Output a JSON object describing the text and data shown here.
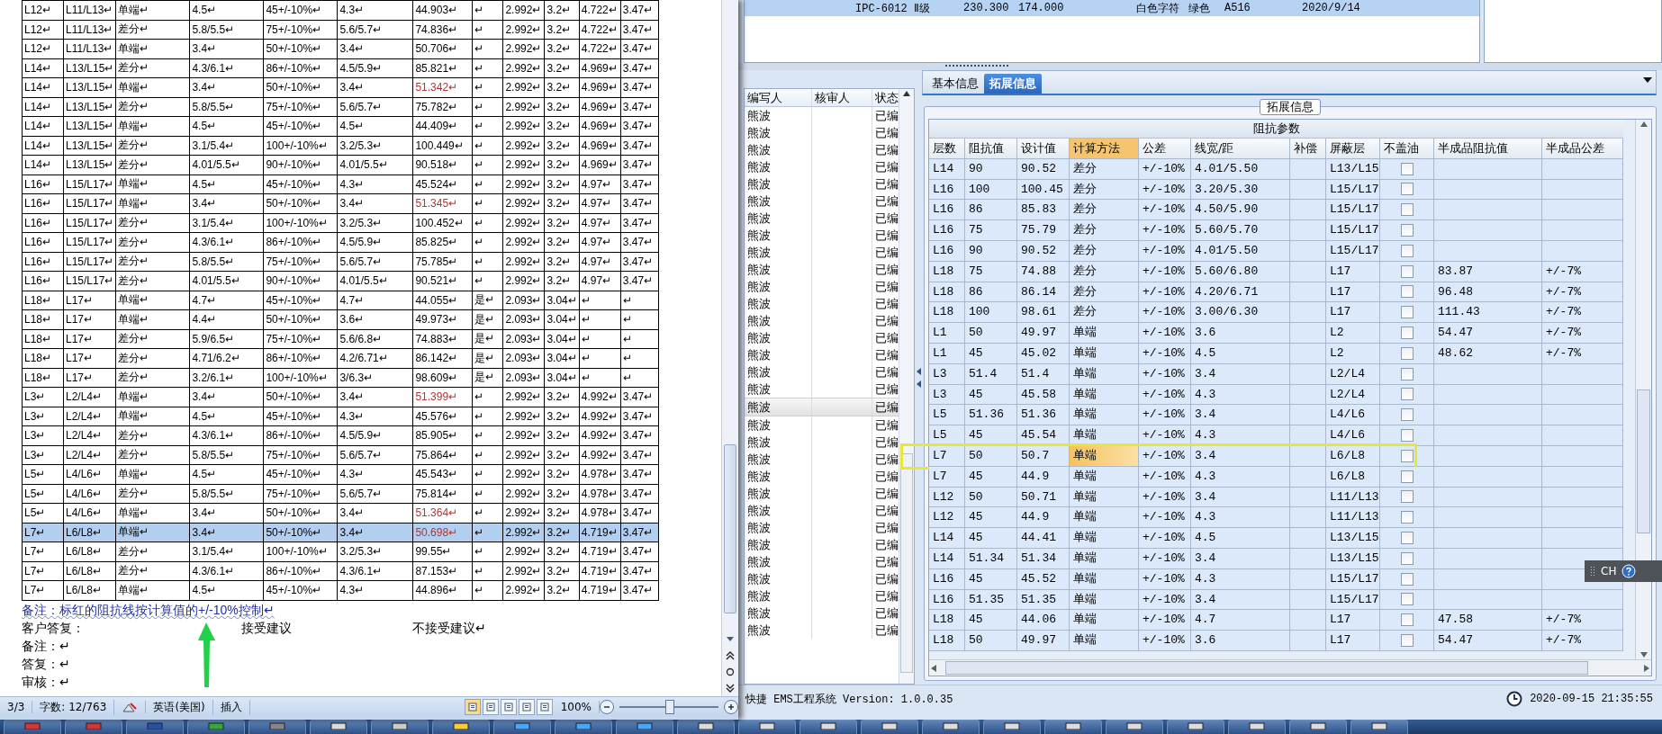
{
  "document": {
    "table": {
      "rows": [
        {
          "cells": [
            "L12↵",
            "L11/L13↵",
            "单端↵",
            "4.5↵",
            "45+/-10%↵",
            "4.3↵",
            "44.903↵",
            "↵",
            "2.992↵",
            "3.2↵",
            "4.722↵",
            "3.47↵"
          ],
          "flagged": false,
          "selected": false
        },
        {
          "cells": [
            "L12↵",
            "L11/L13↵",
            "差分↵",
            "5.8/5.5↵",
            "75+/-10%↵",
            "5.6/5.7↵",
            "74.836↵",
            "↵",
            "2.992↵",
            "3.2↵",
            "4.722↵",
            "3.47↵"
          ],
          "flagged": false,
          "selected": false
        },
        {
          "cells": [
            "L12↵",
            "L11/L13↵",
            "单端↵",
            "3.4↵",
            "50+/-10%↵",
            "3.4↵",
            "50.706↵",
            "↵",
            "2.992↵",
            "3.2↵",
            "4.722↵",
            "3.47↵"
          ],
          "flagged": false,
          "selected": false
        },
        {
          "cells": [
            "L14↵",
            "L13/L15↵",
            "差分↵",
            "4.3/6.1↵",
            "86+/-10%↵",
            "4.5/5.9↵",
            "85.821↵",
            "↵",
            "2.992↵",
            "3.2↵",
            "4.969↵",
            "3.47↵"
          ],
          "flagged": false,
          "selected": false
        },
        {
          "cells": [
            "L14↵",
            "L13/L15↵",
            "单端↵",
            "3.4↵",
            "50+/-10%↵",
            "3.4↵",
            "51.342↵",
            "↵",
            "2.992↵",
            "3.2↵",
            "4.969↵",
            "3.47↵"
          ],
          "flagged": true,
          "selected": false
        },
        {
          "cells": [
            "L14↵",
            "L13/L15↵",
            "差分↵",
            "5.8/5.5↵",
            "75+/-10%↵",
            "5.6/5.7↵",
            "75.782↵",
            "↵",
            "2.992↵",
            "3.2↵",
            "4.969↵",
            "3.47↵"
          ],
          "flagged": false,
          "selected": false
        },
        {
          "cells": [
            "L14↵",
            "L13/L15↵",
            "单端↵",
            "4.5↵",
            "45+/-10%↵",
            "4.5↵",
            "44.409↵",
            "↵",
            "2.992↵",
            "3.2↵",
            "4.969↵",
            "3.47↵"
          ],
          "flagged": false,
          "selected": false
        },
        {
          "cells": [
            "L14↵",
            "L13/L15↵",
            "差分↵",
            "3.1/5.4↵",
            "100+/-10%↵",
            "3.2/5.3↵",
            "100.449↵",
            "↵",
            "2.992↵",
            "3.2↵",
            "4.969↵",
            "3.47↵"
          ],
          "flagged": false,
          "selected": false
        },
        {
          "cells": [
            "L14↵",
            "L13/L15↵",
            "差分↵",
            "4.01/5.5↵",
            "90+/-10%↵",
            "4.01/5.5↵",
            "90.518↵",
            "↵",
            "2.992↵",
            "3.2↵",
            "4.969↵",
            "3.47↵"
          ],
          "flagged": false,
          "selected": false
        },
        {
          "cells": [
            "L16↵",
            "L15/L17↵",
            "单端↵",
            "4.5↵",
            "45+/-10%↵",
            "4.3↵",
            "45.524↵",
            "↵",
            "2.992↵",
            "3.2↵",
            "4.97↵",
            "3.47↵"
          ],
          "flagged": false,
          "selected": false
        },
        {
          "cells": [
            "L16↵",
            "L15/L17↵",
            "单端↵",
            "3.4↵",
            "50+/-10%↵",
            "3.4↵",
            "51.345↵",
            "↵",
            "2.992↵",
            "3.2↵",
            "4.97↵",
            "3.47↵"
          ],
          "flagged": true,
          "selected": false
        },
        {
          "cells": [
            "L16↵",
            "L15/L17↵",
            "差分↵",
            "3.1/5.4↵",
            "100+/-10%↵",
            "3.2/5.3↵",
            "100.452↵",
            "↵",
            "2.992↵",
            "3.2↵",
            "4.97↵",
            "3.47↵"
          ],
          "flagged": false,
          "selected": false
        },
        {
          "cells": [
            "L16↵",
            "L15/L17↵",
            "差分↵",
            "4.3/6.1↵",
            "86+/-10%↵",
            "4.5/5.9↵",
            "85.825↵",
            "↵",
            "2.992↵",
            "3.2↵",
            "4.97↵",
            "3.47↵"
          ],
          "flagged": false,
          "selected": false
        },
        {
          "cells": [
            "L16↵",
            "L15/L17↵",
            "差分↵",
            "5.8/5.5↵",
            "75+/-10%↵",
            "5.6/5.7↵",
            "75.785↵",
            "↵",
            "2.992↵",
            "3.2↵",
            "4.97↵",
            "3.47↵"
          ],
          "flagged": false,
          "selected": false
        },
        {
          "cells": [
            "L16↵",
            "L15/L17↵",
            "差分↵",
            "4.01/5.5↵",
            "90+/-10%↵",
            "4.01/5.5↵",
            "90.521↵",
            "↵",
            "2.992↵",
            "3.2↵",
            "4.97↵",
            "3.47↵"
          ],
          "flagged": false,
          "selected": false
        },
        {
          "cells": [
            "L18↵",
            "L17↵",
            "单端↵",
            "4.7↵",
            "45+/-10%↵",
            "4.7↵",
            "44.055↵",
            "是↵",
            "2.093↵",
            "3.04↵",
            "↵",
            "↵"
          ],
          "flagged": false,
          "selected": false
        },
        {
          "cells": [
            "L18↵",
            "L17↵",
            "单端↵",
            "4.4↵",
            "50+/-10%↵",
            "3.6↵",
            "49.973↵",
            "是↵",
            "2.093↵",
            "3.04↵",
            "↵",
            "↵"
          ],
          "flagged": false,
          "selected": false
        },
        {
          "cells": [
            "L18↵",
            "L17↵",
            "差分↵",
            "5.9/6.5↵",
            "75+/-10%↵",
            "5.6/6.8↵",
            "74.883↵",
            "是↵",
            "2.093↵",
            "3.04↵",
            "↵",
            "↵"
          ],
          "flagged": false,
          "selected": false
        },
        {
          "cells": [
            "L18↵",
            "L17↵",
            "差分↵",
            "4.71/6.2↵",
            "86+/-10%↵",
            "4.2/6.71↵",
            "86.142↵",
            "是↵",
            "2.093↵",
            "3.04↵",
            "↵",
            "↵"
          ],
          "flagged": false,
          "selected": false
        },
        {
          "cells": [
            "L18↵",
            "L17↵",
            "差分↵",
            "3.2/6.1↵",
            "100+/-10%↵",
            "3/6.3↵",
            "98.609↵",
            "是↵",
            "2.093↵",
            "3.04↵",
            "↵",
            "↵"
          ],
          "flagged": false,
          "selected": false
        },
        {
          "cells": [
            "L3↵",
            "L2/L4↵",
            "单端↵",
            "3.4↵",
            "50+/-10%↵",
            "3.4↵",
            "51.399↵",
            "↵",
            "2.992↵",
            "3.2↵",
            "4.992↵",
            "3.47↵"
          ],
          "flagged": true,
          "selected": false
        },
        {
          "cells": [
            "L3↵",
            "L2/L4↵",
            "单端↵",
            "4.5↵",
            "45+/-10%↵",
            "4.3↵",
            "45.576↵",
            "↵",
            "2.992↵",
            "3.2↵",
            "4.992↵",
            "3.47↵"
          ],
          "flagged": false,
          "selected": false
        },
        {
          "cells": [
            "L3↵",
            "L2/L4↵",
            "差分↵",
            "4.3/6.1↵",
            "86+/-10%↵",
            "4.5/5.9↵",
            "85.905↵",
            "↵",
            "2.992↵",
            "3.2↵",
            "4.992↵",
            "3.47↵"
          ],
          "flagged": false,
          "selected": false
        },
        {
          "cells": [
            "L3↵",
            "L2/L4↵",
            "差分↵",
            "5.8/5.5↵",
            "75+/-10%↵",
            "5.6/5.7↵",
            "75.864↵",
            "↵",
            "2.992↵",
            "3.2↵",
            "4.992↵",
            "3.47↵"
          ],
          "flagged": false,
          "selected": false
        },
        {
          "cells": [
            "L5↵",
            "L4/L6↵",
            "单端↵",
            "4.5↵",
            "45+/-10%↵",
            "4.3↵",
            "45.543↵",
            "↵",
            "2.992↵",
            "3.2↵",
            "4.978↵",
            "3.47↵"
          ],
          "flagged": false,
          "selected": false
        },
        {
          "cells": [
            "L5↵",
            "L4/L6↵",
            "差分↵",
            "5.8/5.5↵",
            "75+/-10%↵",
            "5.6/5.7↵",
            "75.814↵",
            "↵",
            "2.992↵",
            "3.2↵",
            "4.978↵",
            "3.47↵"
          ],
          "flagged": false,
          "selected": false
        },
        {
          "cells": [
            "L5↵",
            "L4/L6↵",
            "单端↵",
            "3.4↵",
            "50+/-10%↵",
            "3.4↵",
            "51.364↵",
            "↵",
            "2.992↵",
            "3.2↵",
            "4.978↵",
            "3.47↵"
          ],
          "flagged": true,
          "selected": false
        },
        {
          "cells": [
            "L7↵",
            "L6/L8↵",
            "单端↵",
            "3.4↵",
            "50+/-10%↵",
            "3.4↵",
            "50.698↵",
            "↵",
            "2.992↵",
            "3.2↵",
            "4.719↵",
            "3.47↵"
          ],
          "flagged": true,
          "selected": true
        },
        {
          "cells": [
            "L7↵",
            "L6/L8↵",
            "差分↵",
            "3.1/5.4↵",
            "100+/-10%↵",
            "3.2/5.3↵",
            "99.55↵",
            "↵",
            "2.992↵",
            "3.2↵",
            "4.719↵",
            "3.47↵"
          ],
          "flagged": false,
          "selected": false
        },
        {
          "cells": [
            "L7↵",
            "L6/L8↵",
            "差分↵",
            "4.3/6.1↵",
            "86+/-10%↵",
            "4.3/6.1↵",
            "87.153↵",
            "↵",
            "2.992↵",
            "3.2↵",
            "4.719↵",
            "3.47↵"
          ],
          "flagged": false,
          "selected": false
        },
        {
          "cells": [
            "L7↵",
            "L6/L8↵",
            "单端↵",
            "4.5↵",
            "45+/-10%↵",
            "4.3↵",
            "44.896↵",
            "↵",
            "2.992↵",
            "3.2↵",
            "4.719↵",
            "3.47↵"
          ],
          "flagged": false,
          "selected": false
        }
      ]
    },
    "note": "备注：标红的阻抗线按计算值的+/-10%控制↵",
    "reply": {
      "label": "客户答复：",
      "accept": "接受建议",
      "reject": "不接受建议↵"
    },
    "lines": [
      "备注：↵",
      "答复：↵",
      "审核：↵"
    ],
    "arrow_annotation": true,
    "status_bar": {
      "page": "3/3",
      "word_count": "字数: 12/763",
      "language": "英语(美国)",
      "mode": "插入",
      "zoom": "100%",
      "level": 0.5
    }
  },
  "app": {
    "top_row": {
      "cells": [
        "IPC-6012 Ⅱ级",
        "230.300",
        "174.000",
        "白色字符",
        "绿色",
        "A516",
        "2020/9/14"
      ],
      "selected": true
    },
    "list": {
      "columns": [
        "编写人",
        "核审人",
        "状态"
      ],
      "rows": [
        {
          "writer": "熊波",
          "status": "已编",
          "selected": false
        },
        {
          "writer": "熊波",
          "status": "已编",
          "selected": false
        },
        {
          "writer": "熊波",
          "status": "已编",
          "selected": false
        },
        {
          "writer": "熊波",
          "status": "已编",
          "selected": false
        },
        {
          "writer": "熊波",
          "status": "已编",
          "selected": false
        },
        {
          "writer": "熊波",
          "status": "已编",
          "selected": false
        },
        {
          "writer": "熊波",
          "status": "已编",
          "selected": false
        },
        {
          "writer": "熊波",
          "status": "已编",
          "selected": false
        },
        {
          "writer": "熊波",
          "status": "已编",
          "selected": false
        },
        {
          "writer": "熊波",
          "status": "已编",
          "selected": false
        },
        {
          "writer": "熊波",
          "status": "已编",
          "selected": false
        },
        {
          "writer": "熊波",
          "status": "已编",
          "selected": false
        },
        {
          "writer": "熊波",
          "status": "已编",
          "selected": false
        },
        {
          "writer": "熊波",
          "status": "已编",
          "selected": false
        },
        {
          "writer": "熊波",
          "status": "已编",
          "selected": false
        },
        {
          "writer": "熊波",
          "status": "已编",
          "selected": false
        },
        {
          "writer": "熊波",
          "status": "已编",
          "selected": false
        },
        {
          "writer": "熊波",
          "status": "已编",
          "selected": true
        },
        {
          "writer": "熊波",
          "status": "已编",
          "selected": false
        },
        {
          "writer": "熊波",
          "status": "已编",
          "selected": false
        },
        {
          "writer": "熊波",
          "status": "已编",
          "selected": false
        },
        {
          "writer": "熊波",
          "status": "已编",
          "selected": false
        },
        {
          "writer": "熊波",
          "status": "已编",
          "selected": false
        },
        {
          "writer": "熊波",
          "status": "已编",
          "selected": false
        },
        {
          "writer": "熊波",
          "status": "已编",
          "selected": false
        },
        {
          "writer": "熊波",
          "status": "已编",
          "selected": false
        },
        {
          "writer": "熊波",
          "status": "已编",
          "selected": false
        },
        {
          "writer": "熊波",
          "status": "已编",
          "selected": false
        },
        {
          "writer": "熊波",
          "status": "已编",
          "selected": false
        },
        {
          "writer": "熊波",
          "status": "已编",
          "selected": false
        },
        {
          "writer": "熊波",
          "status": "已编",
          "selected": false
        }
      ]
    },
    "tabs": [
      {
        "label": "基本信息",
        "selected": false
      },
      {
        "label": "拓展信息",
        "selected": true
      }
    ],
    "group_title": "拓展信息",
    "grid": {
      "title": "阻抗参数",
      "columns": [
        {
          "label": "层数",
          "selected": false
        },
        {
          "label": "阻抗值",
          "selected": false
        },
        {
          "label": "设计值",
          "selected": false
        },
        {
          "label": "计算方法",
          "selected": true
        },
        {
          "label": "公差",
          "selected": false
        },
        {
          "label": "线宽/距",
          "selected": false
        },
        {
          "label": "补偿",
          "selected": false
        },
        {
          "label": "屏蔽层",
          "selected": false
        },
        {
          "label": "不盖油",
          "selected": false
        },
        {
          "label": "半成品阻抗值",
          "selected": false
        },
        {
          "label": "半成品公差",
          "selected": false
        }
      ],
      "rows": [
        {
          "cells": [
            "L14",
            "90",
            "90.52",
            "差分",
            "+/-10%",
            "4.01/5.50",
            "",
            "L13/L15",
            "",
            "",
            ""
          ],
          "checked": false,
          "selected": false,
          "annotated": false
        },
        {
          "cells": [
            "L16",
            "100",
            "100.45",
            "差分",
            "+/-10%",
            "3.20/5.30",
            "",
            "L15/L17",
            "",
            "",
            ""
          ],
          "checked": false,
          "selected": false,
          "annotated": false
        },
        {
          "cells": [
            "L16",
            "86",
            "85.83",
            "差分",
            "+/-10%",
            "4.50/5.90",
            "",
            "L15/L17",
            "",
            "",
            ""
          ],
          "checked": false,
          "selected": false,
          "annotated": false
        },
        {
          "cells": [
            "L16",
            "75",
            "75.79",
            "差分",
            "+/-10%",
            "5.60/5.70",
            "",
            "L15/L17",
            "",
            "",
            ""
          ],
          "checked": false,
          "selected": false,
          "annotated": false
        },
        {
          "cells": [
            "L16",
            "90",
            "90.52",
            "差分",
            "+/-10%",
            "4.01/5.50",
            "",
            "L15/L17",
            "",
            "",
            ""
          ],
          "checked": false,
          "selected": false,
          "annotated": false
        },
        {
          "cells": [
            "L18",
            "75",
            "74.88",
            "差分",
            "+/-10%",
            "5.60/6.80",
            "",
            "L17",
            "",
            "83.87",
            "+/-7%"
          ],
          "checked": false,
          "selected": false,
          "annotated": false
        },
        {
          "cells": [
            "L18",
            "86",
            "86.14",
            "差分",
            "+/-10%",
            "4.20/6.71",
            "",
            "L17",
            "",
            "96.48",
            "+/-7%"
          ],
          "checked": false,
          "selected": false,
          "annotated": false
        },
        {
          "cells": [
            "L18",
            "100",
            "98.61",
            "差分",
            "+/-10%",
            "3.00/6.30",
            "",
            "L17",
            "",
            "111.43",
            "+/-7%"
          ],
          "checked": false,
          "selected": false,
          "annotated": false
        },
        {
          "cells": [
            "L1",
            "50",
            "49.97",
            "单端",
            "+/-10%",
            "3.6",
            "",
            "L2",
            "",
            "54.47",
            "+/-7%"
          ],
          "checked": false,
          "selected": false,
          "annotated": false
        },
        {
          "cells": [
            "L1",
            "45",
            "45.02",
            "单端",
            "+/-10%",
            "4.5",
            "",
            "L2",
            "",
            "48.62",
            "+/-7%"
          ],
          "checked": false,
          "selected": false,
          "annotated": false
        },
        {
          "cells": [
            "L3",
            "51.4",
            "51.4",
            "单端",
            "+/-10%",
            "3.4",
            "",
            "L2/L4",
            "",
            "",
            ""
          ],
          "checked": false,
          "selected": false,
          "annotated": false
        },
        {
          "cells": [
            "L3",
            "45",
            "45.58",
            "单端",
            "+/-10%",
            "4.3",
            "",
            "L2/L4",
            "",
            "",
            ""
          ],
          "checked": false,
          "selected": false,
          "annotated": false
        },
        {
          "cells": [
            "L5",
            "51.36",
            "51.36",
            "单端",
            "+/-10%",
            "3.4",
            "",
            "L4/L6",
            "",
            "",
            ""
          ],
          "checked": false,
          "selected": false,
          "annotated": false
        },
        {
          "cells": [
            "L5",
            "45",
            "45.54",
            "单端",
            "+/-10%",
            "4.3",
            "",
            "L4/L6",
            "",
            "",
            ""
          ],
          "checked": false,
          "selected": false,
          "annotated": false
        },
        {
          "cells": [
            "L7",
            "50",
            "50.7",
            "单端",
            "+/-10%",
            "3.4",
            "",
            "L6/L8",
            "",
            "",
            ""
          ],
          "checked": false,
          "selected": true,
          "annotated": true
        },
        {
          "cells": [
            "L7",
            "45",
            "44.9",
            "单端",
            "+/-10%",
            "4.3",
            "",
            "L6/L8",
            "",
            "",
            ""
          ],
          "checked": false,
          "selected": false,
          "annotated": false
        },
        {
          "cells": [
            "L12",
            "50",
            "50.71",
            "单端",
            "+/-10%",
            "3.4",
            "",
            "L11/L13",
            "",
            "",
            ""
          ],
          "checked": false,
          "selected": false,
          "annotated": false
        },
        {
          "cells": [
            "L12",
            "45",
            "44.9",
            "单端",
            "+/-10%",
            "4.3",
            "",
            "L11/L13",
            "",
            "",
            ""
          ],
          "checked": false,
          "selected": false,
          "annotated": false
        },
        {
          "cells": [
            "L14",
            "45",
            "44.41",
            "单端",
            "+/-10%",
            "4.5",
            "",
            "L13/L15",
            "",
            "",
            ""
          ],
          "checked": false,
          "selected": false,
          "annotated": false
        },
        {
          "cells": [
            "L14",
            "51.34",
            "51.34",
            "单端",
            "+/-10%",
            "3.4",
            "",
            "L13/L15",
            "",
            "",
            ""
          ],
          "checked": false,
          "selected": false,
          "annotated": false
        },
        {
          "cells": [
            "L16",
            "45",
            "45.52",
            "单端",
            "+/-10%",
            "4.3",
            "",
            "L15/L17",
            "",
            "",
            ""
          ],
          "checked": false,
          "selected": false,
          "annotated": false
        },
        {
          "cells": [
            "L16",
            "51.35",
            "51.35",
            "单端",
            "+/-10%",
            "3.4",
            "",
            "L15/L17",
            "",
            "",
            ""
          ],
          "checked": false,
          "selected": false,
          "annotated": false
        },
        {
          "cells": [
            "L18",
            "45",
            "44.06",
            "单端",
            "+/-10%",
            "4.7",
            "",
            "L17",
            "",
            "47.58",
            "+/-7%"
          ],
          "checked": false,
          "selected": false,
          "annotated": false
        },
        {
          "cells": [
            "L18",
            "50",
            "49.97",
            "单端",
            "+/-10%",
            "3.6",
            "",
            "L17",
            "",
            "54.47",
            "+/-7%"
          ],
          "checked": false,
          "selected": false,
          "annotated": false
        }
      ]
    },
    "status_bar": {
      "text": "快捷 EMS工程系统 Version: 1.0.0.35",
      "datetime": "2020-09-15 21:35:55"
    },
    "language_bar": {
      "label": "CH"
    }
  }
}
